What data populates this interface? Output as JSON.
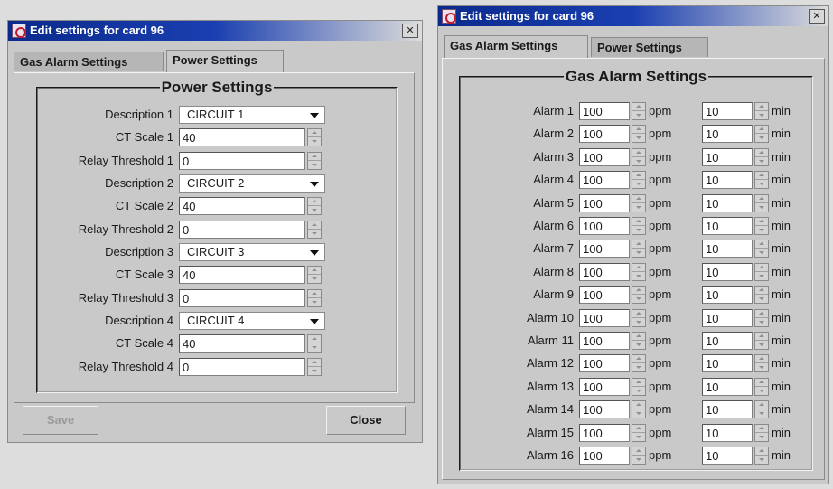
{
  "left_window": {
    "title": "Edit settings for card 96",
    "close_glyph": "✕",
    "tabs": [
      {
        "label": "Gas Alarm Settings",
        "active": true
      },
      {
        "label": "Power Settings",
        "active": false
      }
    ],
    "group_title": "Power Settings",
    "circuits": [
      {
        "description_label": "Description 1",
        "description_value": "CIRCUIT 1",
        "ct_label": "CT Scale 1",
        "ct_value": "40",
        "relay_label": "Relay Threshold 1",
        "relay_value": "0"
      },
      {
        "description_label": "Description 2",
        "description_value": "CIRCUIT 2",
        "ct_label": "CT Scale 2",
        "ct_value": "40",
        "relay_label": "Relay Threshold 2",
        "relay_value": "0"
      },
      {
        "description_label": "Description 3",
        "description_value": "CIRCUIT 3",
        "ct_label": "CT Scale 3",
        "ct_value": "40",
        "relay_label": "Relay Threshold 3",
        "relay_value": "0"
      },
      {
        "description_label": "Description 4",
        "description_value": "CIRCUIT 4",
        "ct_label": "CT Scale 4",
        "ct_value": "40",
        "relay_label": "Relay Threshold 4",
        "relay_value": "0"
      }
    ],
    "save_label": "Save",
    "close_label": "Close"
  },
  "right_window": {
    "title": "Edit settings for card 96",
    "close_glyph": "✕",
    "tabs": [
      {
        "label": "Gas Alarm Settings",
        "active": true
      },
      {
        "label": "Power Settings",
        "active": false
      }
    ],
    "group_title": "Gas Alarm Settings",
    "ppm_unit": "ppm",
    "min_unit": "min",
    "alarms": [
      {
        "label": "Alarm 1",
        "ppm": "100",
        "min": "10"
      },
      {
        "label": "Alarm 2",
        "ppm": "100",
        "min": "10"
      },
      {
        "label": "Alarm 3",
        "ppm": "100",
        "min": "10"
      },
      {
        "label": "Alarm 4",
        "ppm": "100",
        "min": "10"
      },
      {
        "label": "Alarm 5",
        "ppm": "100",
        "min": "10"
      },
      {
        "label": "Alarm 6",
        "ppm": "100",
        "min": "10"
      },
      {
        "label": "Alarm 7",
        "ppm": "100",
        "min": "10"
      },
      {
        "label": "Alarm 8",
        "ppm": "100",
        "min": "10"
      },
      {
        "label": "Alarm 9",
        "ppm": "100",
        "min": "10"
      },
      {
        "label": "Alarm 10",
        "ppm": "100",
        "min": "10"
      },
      {
        "label": "Alarm 11",
        "ppm": "100",
        "min": "10"
      },
      {
        "label": "Alarm 12",
        "ppm": "100",
        "min": "10"
      },
      {
        "label": "Alarm 13",
        "ppm": "100",
        "min": "10"
      },
      {
        "label": "Alarm 14",
        "ppm": "100",
        "min": "10"
      },
      {
        "label": "Alarm 15",
        "ppm": "100",
        "min": "10"
      },
      {
        "label": "Alarm 16",
        "ppm": "100",
        "min": "10"
      }
    ]
  },
  "colors": {
    "titlebar_start": "#0a2a8c",
    "window_bg": "#c9c9c9"
  }
}
